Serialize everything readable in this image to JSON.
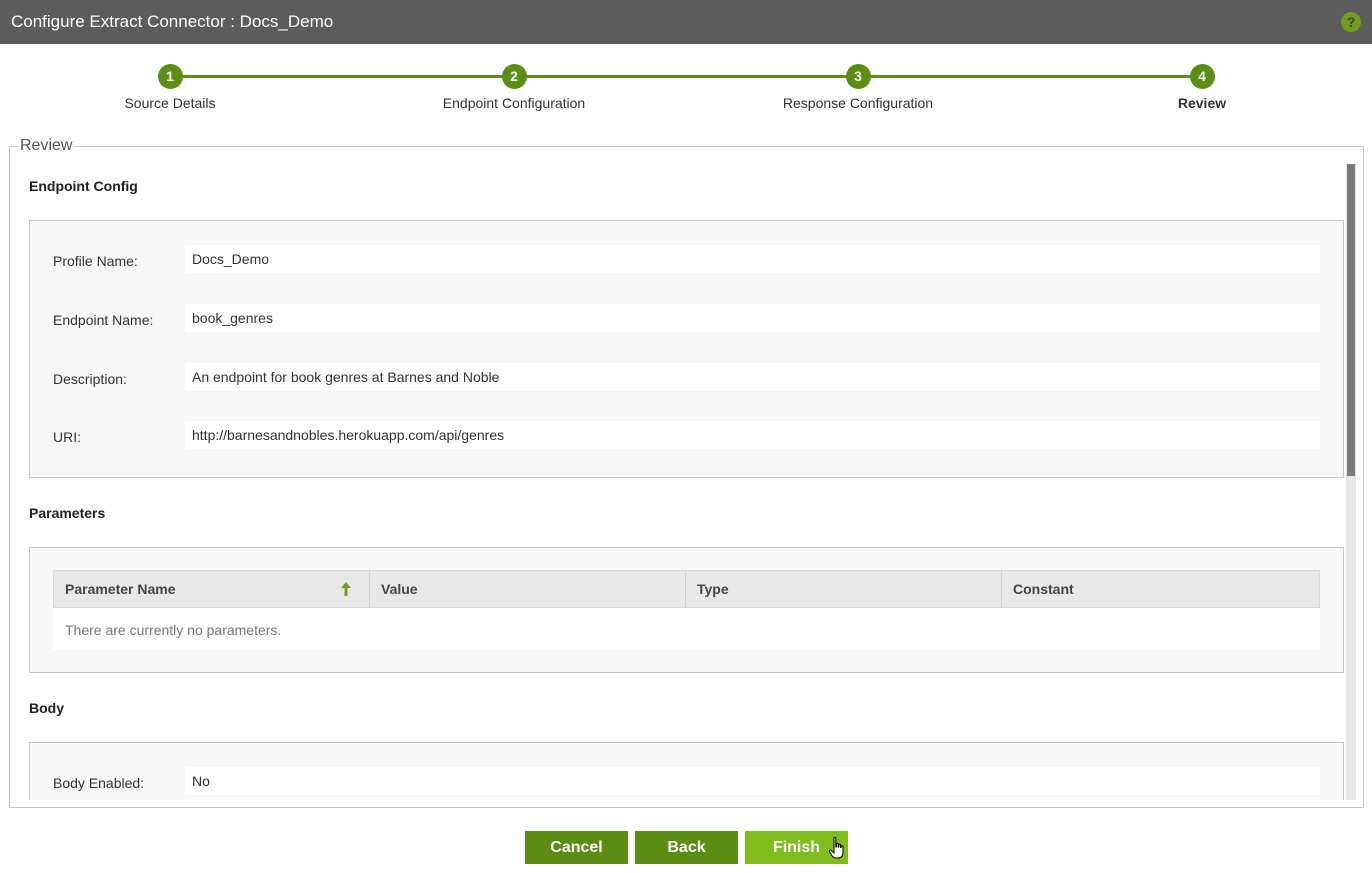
{
  "window": {
    "title": "Configure Extract Connector : Docs_Demo",
    "help_icon": "?"
  },
  "steps": [
    {
      "number": "1",
      "label": "Source Details"
    },
    {
      "number": "2",
      "label": "Endpoint Configuration"
    },
    {
      "number": "3",
      "label": "Response Configuration"
    },
    {
      "number": "4",
      "label": "Review",
      "active": true
    }
  ],
  "review": {
    "legend": "Review",
    "endpoint_config": {
      "title": "Endpoint Config",
      "fields": [
        {
          "label": "Profile Name:",
          "value": "Docs_Demo"
        },
        {
          "label": "Endpoint Name:",
          "value": "book_genres"
        },
        {
          "label": "Description:",
          "value": "An endpoint for book genres at Barnes and Noble"
        },
        {
          "label": "URI:",
          "value": "http://barnesandnobles.herokuapp.com/api/genres"
        }
      ]
    },
    "parameters": {
      "title": "Parameters",
      "columns": [
        "Parameter Name",
        "Value",
        "Type",
        "Constant"
      ],
      "empty_message": "There are currently no parameters."
    },
    "body": {
      "title": "Body",
      "fields": [
        {
          "label": "Body Enabled:",
          "value": "No"
        }
      ]
    }
  },
  "buttons": {
    "cancel": "Cancel",
    "back": "Back",
    "finish": "Finish"
  },
  "colors": {
    "accent": "#5b8c14",
    "accent_light": "#7fbc1c",
    "titlebar": "#5c5c5c"
  }
}
